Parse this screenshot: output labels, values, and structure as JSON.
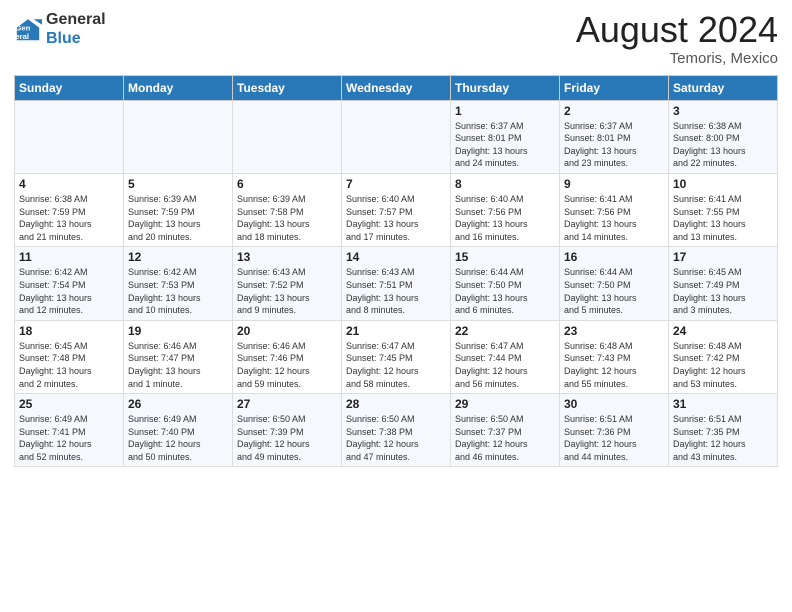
{
  "logo": {
    "line1": "General",
    "line2": "Blue"
  },
  "title": "August 2024",
  "subtitle": "Temoris, Mexico",
  "days_of_week": [
    "Sunday",
    "Monday",
    "Tuesday",
    "Wednesday",
    "Thursday",
    "Friday",
    "Saturday"
  ],
  "weeks": [
    [
      {
        "num": "",
        "info": ""
      },
      {
        "num": "",
        "info": ""
      },
      {
        "num": "",
        "info": ""
      },
      {
        "num": "",
        "info": ""
      },
      {
        "num": "1",
        "info": "Sunrise: 6:37 AM\nSunset: 8:01 PM\nDaylight: 13 hours\nand 24 minutes."
      },
      {
        "num": "2",
        "info": "Sunrise: 6:37 AM\nSunset: 8:01 PM\nDaylight: 13 hours\nand 23 minutes."
      },
      {
        "num": "3",
        "info": "Sunrise: 6:38 AM\nSunset: 8:00 PM\nDaylight: 13 hours\nand 22 minutes."
      }
    ],
    [
      {
        "num": "4",
        "info": "Sunrise: 6:38 AM\nSunset: 7:59 PM\nDaylight: 13 hours\nand 21 minutes."
      },
      {
        "num": "5",
        "info": "Sunrise: 6:39 AM\nSunset: 7:59 PM\nDaylight: 13 hours\nand 20 minutes."
      },
      {
        "num": "6",
        "info": "Sunrise: 6:39 AM\nSunset: 7:58 PM\nDaylight: 13 hours\nand 18 minutes."
      },
      {
        "num": "7",
        "info": "Sunrise: 6:40 AM\nSunset: 7:57 PM\nDaylight: 13 hours\nand 17 minutes."
      },
      {
        "num": "8",
        "info": "Sunrise: 6:40 AM\nSunset: 7:56 PM\nDaylight: 13 hours\nand 16 minutes."
      },
      {
        "num": "9",
        "info": "Sunrise: 6:41 AM\nSunset: 7:56 PM\nDaylight: 13 hours\nand 14 minutes."
      },
      {
        "num": "10",
        "info": "Sunrise: 6:41 AM\nSunset: 7:55 PM\nDaylight: 13 hours\nand 13 minutes."
      }
    ],
    [
      {
        "num": "11",
        "info": "Sunrise: 6:42 AM\nSunset: 7:54 PM\nDaylight: 13 hours\nand 12 minutes."
      },
      {
        "num": "12",
        "info": "Sunrise: 6:42 AM\nSunset: 7:53 PM\nDaylight: 13 hours\nand 10 minutes."
      },
      {
        "num": "13",
        "info": "Sunrise: 6:43 AM\nSunset: 7:52 PM\nDaylight: 13 hours\nand 9 minutes."
      },
      {
        "num": "14",
        "info": "Sunrise: 6:43 AM\nSunset: 7:51 PM\nDaylight: 13 hours\nand 8 minutes."
      },
      {
        "num": "15",
        "info": "Sunrise: 6:44 AM\nSunset: 7:50 PM\nDaylight: 13 hours\nand 6 minutes."
      },
      {
        "num": "16",
        "info": "Sunrise: 6:44 AM\nSunset: 7:50 PM\nDaylight: 13 hours\nand 5 minutes."
      },
      {
        "num": "17",
        "info": "Sunrise: 6:45 AM\nSunset: 7:49 PM\nDaylight: 13 hours\nand 3 minutes."
      }
    ],
    [
      {
        "num": "18",
        "info": "Sunrise: 6:45 AM\nSunset: 7:48 PM\nDaylight: 13 hours\nand 2 minutes."
      },
      {
        "num": "19",
        "info": "Sunrise: 6:46 AM\nSunset: 7:47 PM\nDaylight: 13 hours\nand 1 minute."
      },
      {
        "num": "20",
        "info": "Sunrise: 6:46 AM\nSunset: 7:46 PM\nDaylight: 12 hours\nand 59 minutes."
      },
      {
        "num": "21",
        "info": "Sunrise: 6:47 AM\nSunset: 7:45 PM\nDaylight: 12 hours\nand 58 minutes."
      },
      {
        "num": "22",
        "info": "Sunrise: 6:47 AM\nSunset: 7:44 PM\nDaylight: 12 hours\nand 56 minutes."
      },
      {
        "num": "23",
        "info": "Sunrise: 6:48 AM\nSunset: 7:43 PM\nDaylight: 12 hours\nand 55 minutes."
      },
      {
        "num": "24",
        "info": "Sunrise: 6:48 AM\nSunset: 7:42 PM\nDaylight: 12 hours\nand 53 minutes."
      }
    ],
    [
      {
        "num": "25",
        "info": "Sunrise: 6:49 AM\nSunset: 7:41 PM\nDaylight: 12 hours\nand 52 minutes."
      },
      {
        "num": "26",
        "info": "Sunrise: 6:49 AM\nSunset: 7:40 PM\nDaylight: 12 hours\nand 50 minutes."
      },
      {
        "num": "27",
        "info": "Sunrise: 6:50 AM\nSunset: 7:39 PM\nDaylight: 12 hours\nand 49 minutes."
      },
      {
        "num": "28",
        "info": "Sunrise: 6:50 AM\nSunset: 7:38 PM\nDaylight: 12 hours\nand 47 minutes."
      },
      {
        "num": "29",
        "info": "Sunrise: 6:50 AM\nSunset: 7:37 PM\nDaylight: 12 hours\nand 46 minutes."
      },
      {
        "num": "30",
        "info": "Sunrise: 6:51 AM\nSunset: 7:36 PM\nDaylight: 12 hours\nand 44 minutes."
      },
      {
        "num": "31",
        "info": "Sunrise: 6:51 AM\nSunset: 7:35 PM\nDaylight: 12 hours\nand 43 minutes."
      }
    ]
  ]
}
